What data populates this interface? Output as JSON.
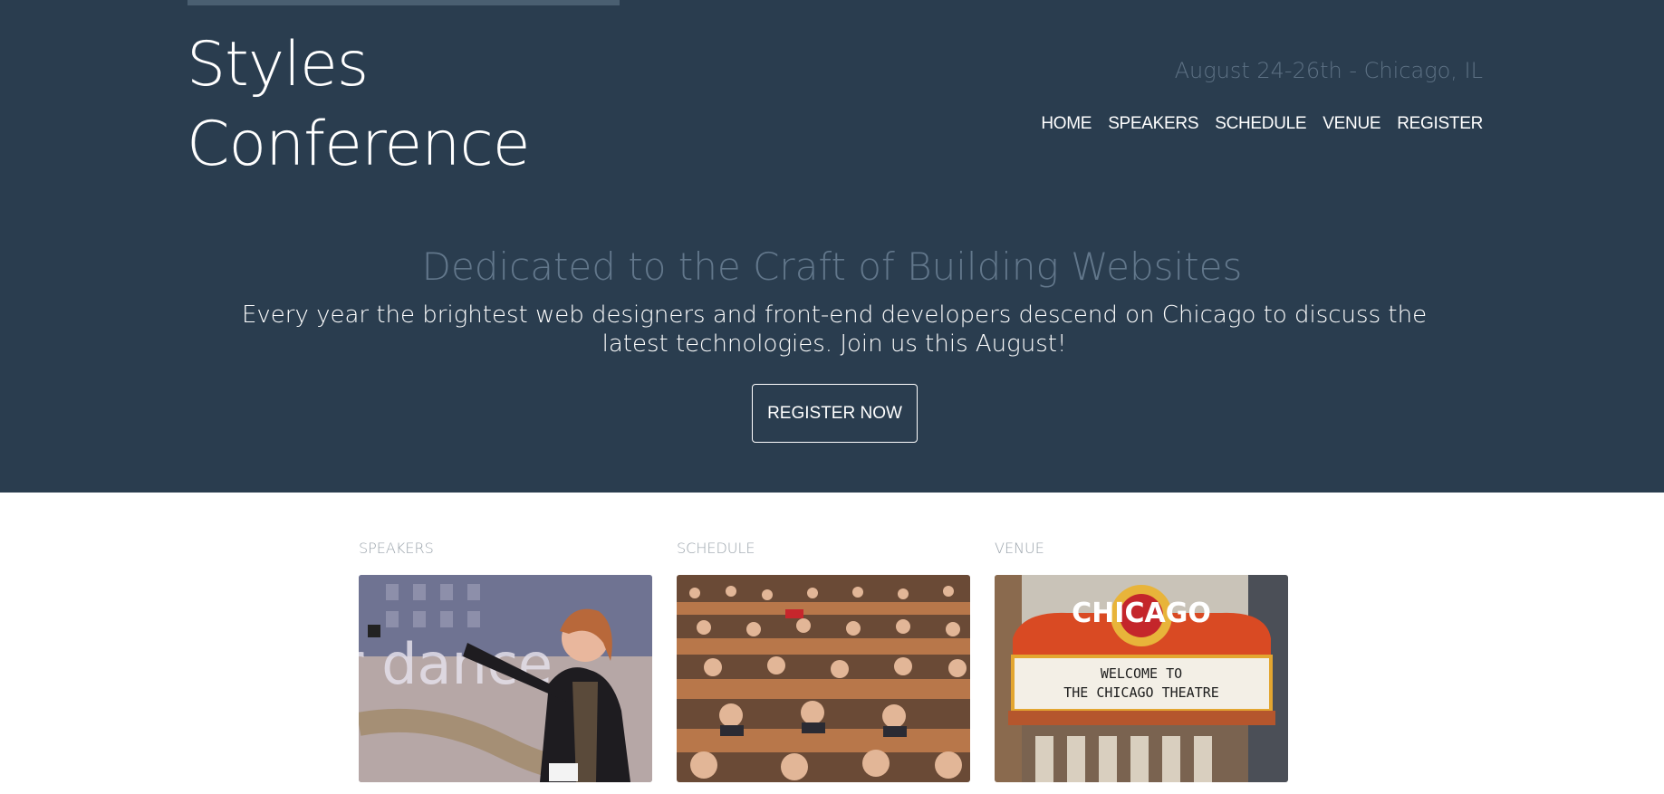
{
  "header": {
    "logo_line1": "Styles",
    "logo_line2": "Conference",
    "tagline": "August 24-26th - Chicago, IL",
    "nav": [
      {
        "label": "HOME"
      },
      {
        "label": "SPEAKERS"
      },
      {
        "label": "SCHEDULE"
      },
      {
        "label": "VENUE"
      },
      {
        "label": "REGISTER"
      }
    ]
  },
  "hero": {
    "headline": "Dedicated to the Craft of Building Websites",
    "lead": "Every year the brightest web designers and front-end developers descend on Chicago to discuss the latest technologies. Join us this August!",
    "cta_label": "REGISTER NOW"
  },
  "teasers": [
    {
      "title": "SPEAKERS"
    },
    {
      "title": "SCHEDULE"
    },
    {
      "title": "VENUE"
    }
  ],
  "colors": {
    "hero_background": "#2a3d4f",
    "muted_text": "#62778b",
    "body_background": "#ffffff"
  }
}
